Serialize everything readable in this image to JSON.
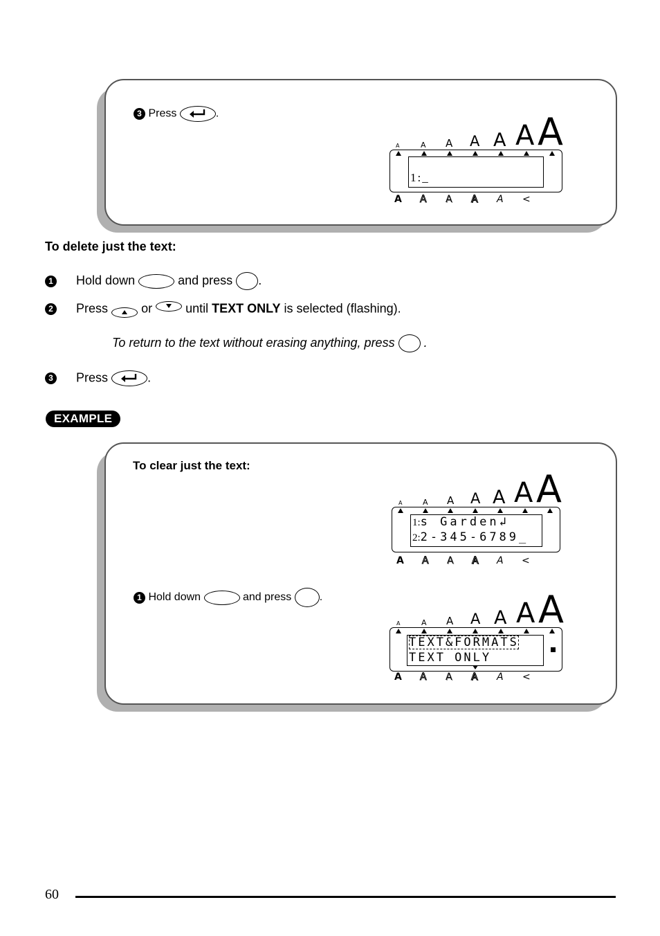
{
  "top_panel": {
    "step_number": "3",
    "step_text": "Press",
    "step_key": "enter-key",
    "step_suffix": ".",
    "lcd": {
      "size_indicators": [
        "A",
        "A",
        "A",
        "A",
        "A",
        "A",
        "A"
      ],
      "line1": "1:_",
      "style_indicators": [
        "A",
        "A",
        "A",
        "A",
        "A",
        "<"
      ]
    }
  },
  "section": {
    "heading": "To delete just the text:",
    "steps": [
      {
        "number": "1",
        "text_before": "Hold down",
        "text_middle": "and press",
        "text_after": "."
      },
      {
        "number": "2",
        "text_before": "Press",
        "text_or": "or",
        "text_until": "until",
        "bold": "TEXT ONLY",
        "text_after": "is selected (flashing)."
      },
      {
        "number": "3",
        "text_before": "Press",
        "text_after": "."
      }
    ],
    "note": "To return to the text without erasing anything, press",
    "note_suffix": "."
  },
  "example": {
    "badge": "EXAMPLE",
    "heading": "To clear just the text:",
    "lcd1": {
      "line1_num": "1:",
      "line1": "s Garden↲",
      "line2_num": "2:",
      "line2": "2-345-6789_",
      "style_indicators": [
        "A",
        "A",
        "A",
        "A",
        "A",
        "<"
      ]
    },
    "step": {
      "number": "1",
      "text_before": "Hold down",
      "text_middle": "and press",
      "text_after": "."
    },
    "lcd2": {
      "line1": "TEXT&FORMATS",
      "line2": "TEXT ONLY",
      "style_indicators": [
        "A",
        "A",
        "A",
        "A",
        "A",
        "<"
      ]
    }
  },
  "footer": {
    "page_number": "60"
  }
}
